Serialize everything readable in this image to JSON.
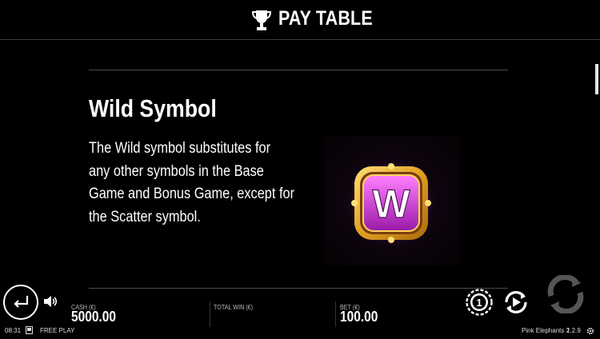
{
  "header": {
    "title": "PAY TABLE",
    "icon": "trophy-icon"
  },
  "section": {
    "title": "Wild Symbol",
    "description_lines": [
      "The Wild symbol substitutes for",
      "any other symbols in the Base",
      "Game and Bonus Game, except for",
      "the Scatter symbol."
    ],
    "symbol_letter": "W"
  },
  "footer": {
    "cash_label": "CASH (€)",
    "cash_value": "5000.00",
    "total_win_label": "TOTAL WIN (€)",
    "bet_label": "BET (€)",
    "bet_value": "100.00"
  },
  "status": {
    "time": "08:31",
    "mode": "FREE PLAY",
    "game_name": "Pink Elephants 2",
    "version": "1.2.9"
  },
  "colors": {
    "background": "#000000",
    "symbol_gold": "#e0a020",
    "symbol_pink": "#e040e0"
  }
}
